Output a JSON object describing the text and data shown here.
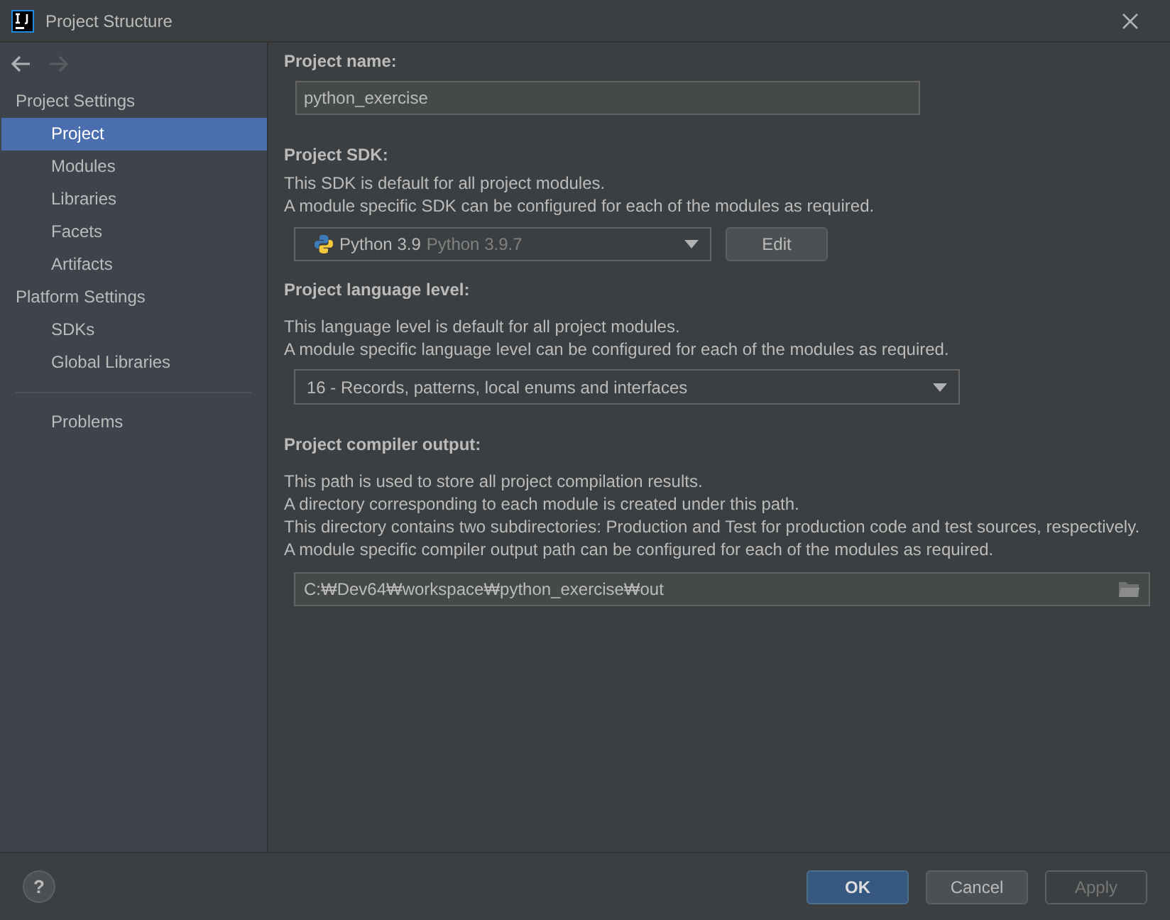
{
  "window": {
    "title": "Project Structure"
  },
  "nav": {
    "back_disabled": false,
    "forward_disabled": true
  },
  "sidebar": {
    "items": [
      {
        "kind": "header",
        "label": "Project Settings"
      },
      {
        "kind": "item",
        "label": "Project",
        "selected": true
      },
      {
        "kind": "item",
        "label": "Modules",
        "selected": false
      },
      {
        "kind": "item",
        "label": "Libraries",
        "selected": false
      },
      {
        "kind": "item",
        "label": "Facets",
        "selected": false
      },
      {
        "kind": "item",
        "label": "Artifacts",
        "selected": false
      },
      {
        "kind": "header",
        "label": "Platform Settings"
      },
      {
        "kind": "item",
        "label": "SDKs",
        "selected": false
      },
      {
        "kind": "item",
        "label": "Global Libraries",
        "selected": false
      },
      {
        "kind": "separator"
      },
      {
        "kind": "item",
        "label": "Problems",
        "selected": false
      }
    ]
  },
  "project_name": {
    "label": "Project name:",
    "value": "python_exercise"
  },
  "project_sdk": {
    "label": "Project SDK:",
    "description": [
      "This SDK is default for all project modules.",
      "A module specific SDK can be configured for each of the modules as required."
    ],
    "value": "Python 3.9",
    "detail": "Python 3.9.7",
    "edit_button": "Edit"
  },
  "language_level": {
    "label": "Project language level:",
    "description": [
      "This language level is default for all project modules.",
      "A module specific language level can be configured for each of the modules as required."
    ],
    "value": "16 - Records, patterns, local enums and interfaces"
  },
  "compiler_output": {
    "label": "Project compiler output:",
    "description": [
      "This path is used to store all project compilation results.",
      "A directory corresponding to each module is created under this path.",
      "This directory contains two subdirectories: Production and Test for production code and test sources, respectively.",
      "A module specific compiler output path can be configured for each of the modules as required."
    ],
    "value": "C:₩Dev64₩workspace₩python_exercise₩out"
  },
  "footer": {
    "help": "?",
    "buttons": [
      {
        "label": "OK",
        "kind": "primary",
        "disabled": false
      },
      {
        "label": "Cancel",
        "kind": "normal",
        "disabled": false
      },
      {
        "label": "Apply",
        "kind": "normal",
        "disabled": true
      }
    ]
  }
}
